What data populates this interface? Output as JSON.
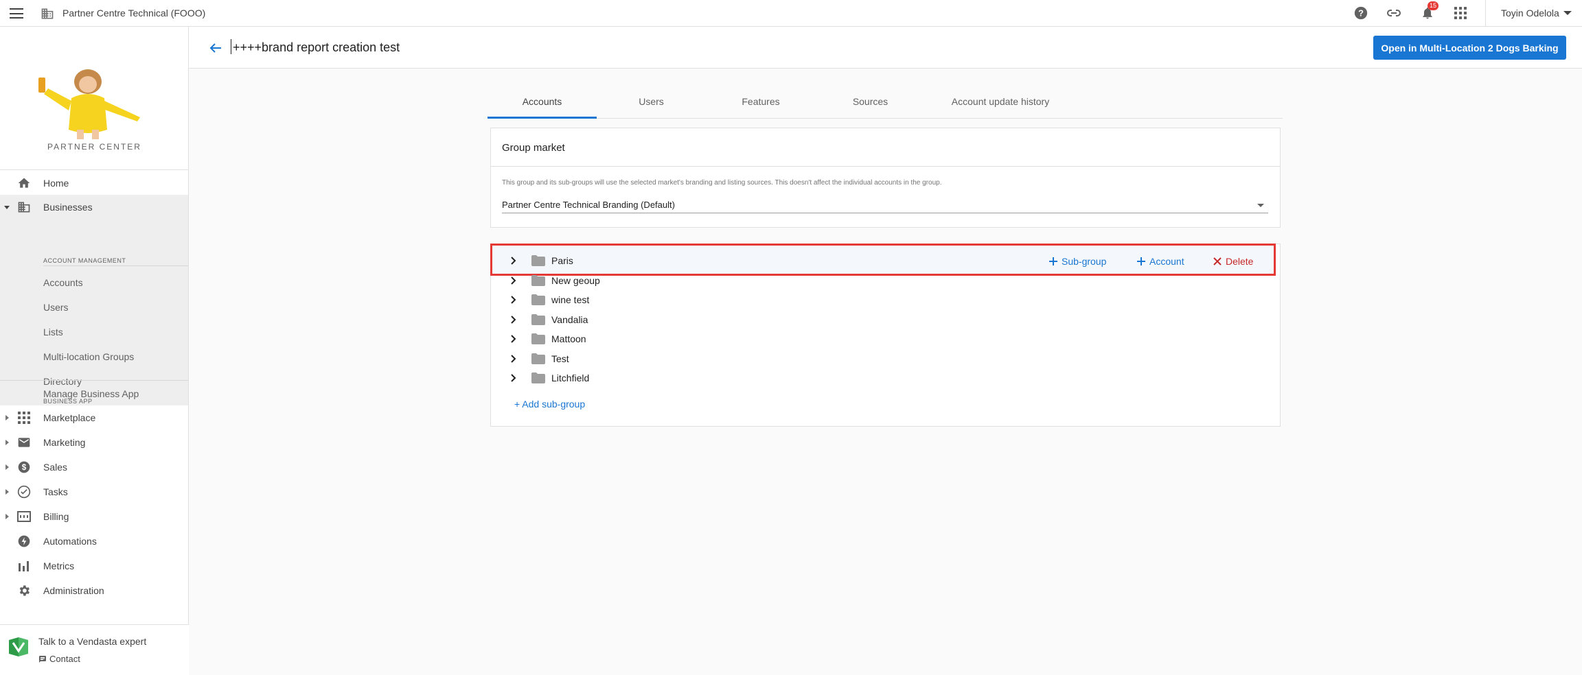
{
  "topbar": {
    "org_name": "Partner Centre Technical (FOOO)",
    "notification_count": "15",
    "user_name": "Toyin Odelola"
  },
  "sidebar": {
    "logo_text": "PARTNER CENTER",
    "nav": {
      "home": "Home",
      "businesses": "Businesses",
      "marketplace": "Marketplace",
      "marketing": "Marketing",
      "sales": "Sales",
      "tasks": "Tasks",
      "billing": "Billing",
      "automations": "Automations",
      "metrics": "Metrics",
      "administration": "Administration"
    },
    "businesses_sub": {
      "account_management_header": "ACCOUNT MANAGEMENT",
      "accounts": "Accounts",
      "users": "Users",
      "lists": "Lists",
      "multi_location_groups": "Multi-location Groups",
      "directory": "Directory",
      "business_app_header": "BUSINESS APP",
      "manage_business_app": "Manage Business App"
    },
    "help": {
      "talk_label": "Talk to a Vendasta expert",
      "contact_label": "Contact"
    }
  },
  "header": {
    "title": "++++brand report creation test",
    "open_button": "Open in Multi-Location 2 Dogs Barking"
  },
  "tabs": [
    {
      "label": "Accounts",
      "active": true
    },
    {
      "label": "Users",
      "active": false
    },
    {
      "label": "Features",
      "active": false
    },
    {
      "label": "Sources",
      "active": false
    },
    {
      "label": "Account update history",
      "active": false
    }
  ],
  "group_market": {
    "title": "Group market",
    "description": "This group and its sub-groups will use the selected market's branding and listing sources. This doesn't affect the individual accounts in the group.",
    "selected": "Partner Centre Technical Branding (Default)"
  },
  "groups": {
    "items": [
      "Paris",
      "New geoup",
      "wine test",
      "Vandalia",
      "Mattoon",
      "Test",
      "Litchfield"
    ],
    "actions": {
      "sub_group": "Sub-group",
      "account": "Account",
      "delete": "Delete"
    },
    "add_sub_group": "+ Add sub-group"
  },
  "colors": {
    "primary": "#1976d2",
    "danger": "#c62828",
    "highlight_border": "#e53935"
  }
}
